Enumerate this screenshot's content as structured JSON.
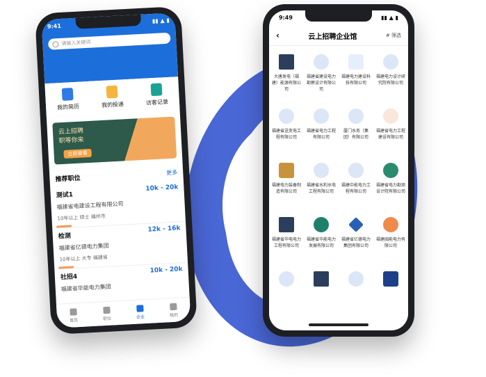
{
  "left_phone": {
    "status": {
      "time": "9:41",
      "icons": "▮▮ ▲ ▮"
    },
    "search": {
      "placeholder": "请输入关键词"
    },
    "quick_actions": [
      {
        "label": "我的简历",
        "icon": "resume-icon",
        "color": "#2d7be5"
      },
      {
        "label": "我的投递",
        "icon": "delivery-icon",
        "color": "#f5b53d"
      },
      {
        "label": "访客记录",
        "icon": "visitor-icon",
        "color": "#1aa394"
      }
    ],
    "banner": {
      "line1": "云上招聘",
      "line2": "职等你来",
      "button": "立即查看"
    },
    "section": {
      "title": "推荐职位",
      "more": "更多"
    },
    "jobs": [
      {
        "title": "测试1",
        "salary": "10k - 20k",
        "company": "福建省电建设工程有限公司",
        "meta": "10年以上   硕士   福州市"
      },
      {
        "title": "检测",
        "salary": "12k - 16k",
        "company": "福建省亿德电力集团",
        "meta": "10年以上   大专   福建省"
      },
      {
        "title": "社招4",
        "salary": "10k - 20k",
        "company": "福建省华能电力集团",
        "meta": ""
      }
    ],
    "tabs": [
      {
        "label": "首页",
        "icon": "home-icon"
      },
      {
        "label": "职位",
        "icon": "job-icon"
      },
      {
        "label": "企业",
        "icon": "company-icon"
      },
      {
        "label": "我的",
        "icon": "profile-icon"
      }
    ]
  },
  "right_phone": {
    "status": {
      "time": "9:49",
      "icons": "▮▮ ▲ ▮"
    },
    "nav": {
      "back": "‹",
      "title": "云上招聘企业馆",
      "actions": "#   筛选"
    },
    "companies": [
      {
        "name": "大唐发电（福建）能源有限公司",
        "logo": "square-logo-icon"
      },
      {
        "name": "福建省建设电力勘察设计有限公司",
        "logo": "person-icon"
      },
      {
        "name": "福建电力建设科技有限公司",
        "logo": "infinity-logo-icon"
      },
      {
        "name": "福建电力设计研究院有限公司",
        "logo": "person-icon"
      },
      {
        "name": "福建省送变电工程有限公司",
        "logo": "person-icon"
      },
      {
        "name": "福建省电力工程有限公司",
        "logo": "person-icon"
      },
      {
        "name": "厦门水务（集团）有限公司",
        "logo": "person-icon"
      },
      {
        "name": "福建省电力工程建设有限公司",
        "logo": "swirl-logo-icon"
      },
      {
        "name": "福建电力装备制造有限公司",
        "logo": "roof-logo-icon"
      },
      {
        "name": "福建省水利水电工程有限公司",
        "logo": "person-icon"
      },
      {
        "name": "福建中能电力工程有限公司",
        "logo": "person-icon"
      },
      {
        "name": "福建省电力勘测设计院有限公司",
        "logo": "gear-logo-icon"
      },
      {
        "name": "福建省华电电力工程有限公司",
        "logo": "square-logo-icon"
      },
      {
        "name": "福建省华能电力发展有限公司",
        "logo": "round-logo-icon"
      },
      {
        "name": "福建省亿德电力集团有限公司",
        "logo": "star-logo-icon"
      },
      {
        "name": "福建闽能电力有限公司",
        "logo": "orange-logo-icon"
      },
      {
        "name": "",
        "logo": "person-icon"
      },
      {
        "name": "",
        "logo": "square-logo-icon"
      },
      {
        "name": "",
        "logo": "person-icon"
      },
      {
        "name": "",
        "logo": "text-logo-icon"
      }
    ]
  },
  "colors": {
    "brand_blue": "#1c6edb",
    "ring_blue": "#4a67d6",
    "accent_orange": "#f39a55"
  }
}
